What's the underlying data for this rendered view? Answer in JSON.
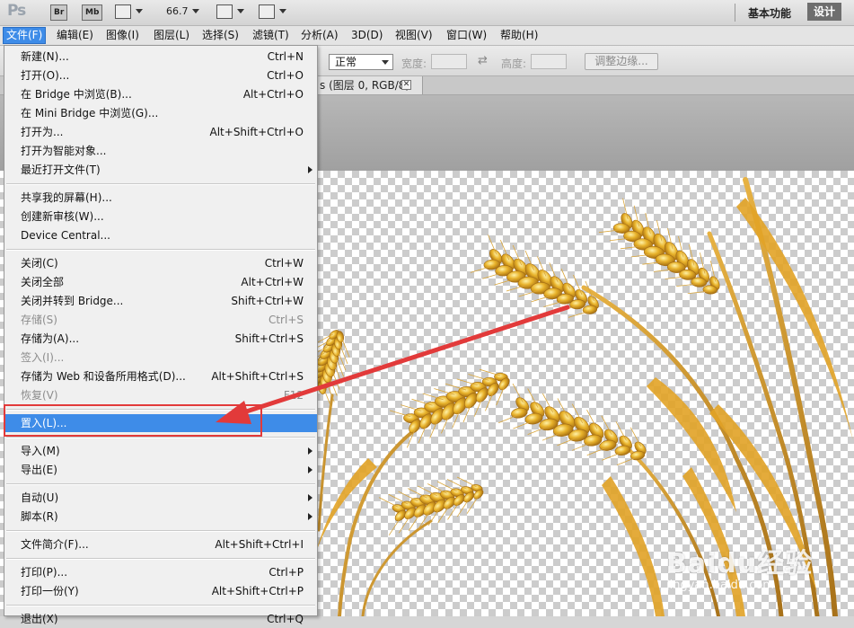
{
  "app": {
    "logo": "Ps",
    "bridge_badge": "Br",
    "minibridge_badge": "Mb",
    "zoom": "66.7",
    "workspace_basic": "基本功能",
    "workspace_design": "设计"
  },
  "menubar": [
    {
      "label": "文件(F)",
      "active": true
    },
    {
      "label": "编辑(E)"
    },
    {
      "label": "图像(I)"
    },
    {
      "label": "图层(L)"
    },
    {
      "label": "选择(S)"
    },
    {
      "label": "滤镜(T)"
    },
    {
      "label": "分析(A)"
    },
    {
      "label": "3D(D)"
    },
    {
      "label": "视图(V)"
    },
    {
      "label": "窗口(W)"
    },
    {
      "label": "帮助(H)"
    }
  ],
  "options": {
    "style_value": "正常",
    "width_label": "宽度:",
    "height_label": "高度:",
    "refine_edge": "调整边缘..."
  },
  "document": {
    "tab_title": "s (图层 0, RGB/8)",
    "close_glyph": "✕"
  },
  "file_menu": [
    {
      "label": "新建(N)...",
      "shortcut": "Ctrl+N"
    },
    {
      "label": "打开(O)...",
      "shortcut": "Ctrl+O"
    },
    {
      "label": "在 Bridge 中浏览(B)...",
      "shortcut": "Alt+Ctrl+O"
    },
    {
      "label": "在 Mini Bridge 中浏览(G)...",
      "shortcut": ""
    },
    {
      "label": "打开为...",
      "shortcut": "Alt+Shift+Ctrl+O"
    },
    {
      "label": "打开为智能对象...",
      "shortcut": ""
    },
    {
      "label": "最近打开文件(T)",
      "shortcut": "",
      "submenu": true
    },
    {
      "separator": true
    },
    {
      "label": "共享我的屏幕(H)...",
      "shortcut": ""
    },
    {
      "label": "创建新审核(W)...",
      "shortcut": ""
    },
    {
      "label": "Device Central...",
      "shortcut": ""
    },
    {
      "separator": true
    },
    {
      "label": "关闭(C)",
      "shortcut": "Ctrl+W"
    },
    {
      "label": "关闭全部",
      "shortcut": "Alt+Ctrl+W"
    },
    {
      "label": "关闭并转到 Bridge...",
      "shortcut": "Shift+Ctrl+W"
    },
    {
      "label": "存储(S)",
      "shortcut": "Ctrl+S",
      "disabled": true
    },
    {
      "label": "存储为(A)...",
      "shortcut": "Shift+Ctrl+S"
    },
    {
      "label": "签入(I)...",
      "shortcut": "",
      "disabled": true
    },
    {
      "label": "存储为 Web 和设备所用格式(D)...",
      "shortcut": "Alt+Shift+Ctrl+S"
    },
    {
      "label": "恢复(V)",
      "shortcut": "F12",
      "disabled": true
    },
    {
      "separator": true
    },
    {
      "label": "置入(L)...",
      "shortcut": "",
      "highlighted": true
    },
    {
      "separator": true
    },
    {
      "label": "导入(M)",
      "shortcut": "",
      "submenu": true
    },
    {
      "label": "导出(E)",
      "shortcut": "",
      "submenu": true
    },
    {
      "separator": true
    },
    {
      "label": "自动(U)",
      "shortcut": "",
      "submenu": true
    },
    {
      "label": "脚本(R)",
      "shortcut": "",
      "submenu": true
    },
    {
      "separator": true
    },
    {
      "label": "文件简介(F)...",
      "shortcut": "Alt+Shift+Ctrl+I"
    },
    {
      "separator": true
    },
    {
      "label": "打印(P)...",
      "shortcut": "Ctrl+P"
    },
    {
      "label": "打印一份(Y)",
      "shortcut": "Alt+Shift+Ctrl+P"
    },
    {
      "separator": true
    },
    {
      "label": "退出(X)",
      "shortcut": "Ctrl+Q"
    }
  ],
  "watermark": {
    "brand": "Baidu经验",
    "url": "jingyan.baidu.com"
  },
  "colors": {
    "highlight": "#3e8ce8",
    "annotation": "#e23a3a",
    "wheat_gold": "#e8b22a"
  }
}
